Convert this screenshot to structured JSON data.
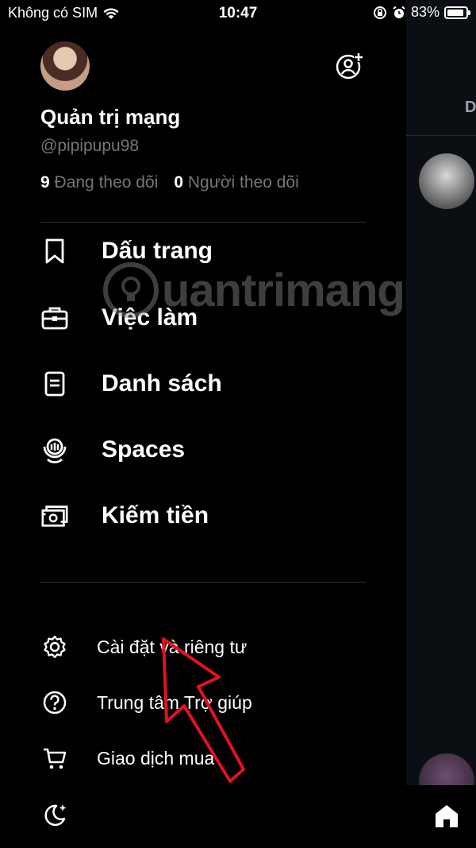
{
  "status_bar": {
    "carrier": "Không có SIM",
    "time": "10:47",
    "battery": "83%"
  },
  "profile": {
    "name": "Quản trị mạng",
    "handle": "@pipipupu98",
    "following_count": "9",
    "following_label": "Đang theo dõi",
    "followers_count": "0",
    "followers_label": "Người theo dõi"
  },
  "menu": {
    "primary": [
      {
        "label": "Dấu trang",
        "icon": "bookmark-icon"
      },
      {
        "label": "Việc làm",
        "icon": "briefcase-icon"
      },
      {
        "label": "Danh sách",
        "icon": "list-icon"
      },
      {
        "label": "Spaces",
        "icon": "spaces-icon"
      },
      {
        "label": "Kiếm tiền",
        "icon": "money-icon"
      }
    ],
    "secondary": [
      {
        "label": "Cài đặt và riêng tư",
        "icon": "gear-icon"
      },
      {
        "label": "Trung tâm Trợ giúp",
        "icon": "help-icon"
      },
      {
        "label": "Giao dịch mua",
        "icon": "cart-icon"
      }
    ],
    "theme_icon": "moon-icon"
  },
  "background": {
    "tab_letter": "D"
  },
  "watermark": {
    "text": "uantrimang"
  },
  "colors": {
    "background": "#000000",
    "text": "#ffffff",
    "muted": "#71767b",
    "divider": "#2f3336",
    "arrow": "#e0141c"
  }
}
